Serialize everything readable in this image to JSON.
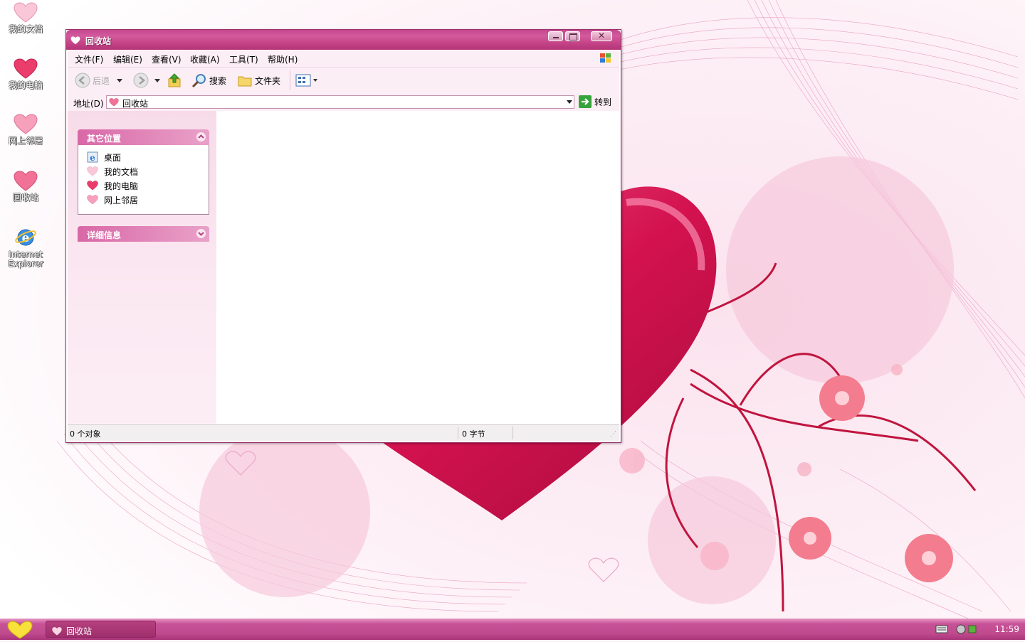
{
  "desktop": {
    "icons": [
      {
        "label": "我的文档"
      },
      {
        "label": "我的电脑"
      },
      {
        "label": "网上邻居"
      },
      {
        "label": "回收站"
      },
      {
        "label": "Internet Explorer"
      }
    ]
  },
  "window": {
    "title": "回收站",
    "menu": [
      "文件(F)",
      "编辑(E)",
      "查看(V)",
      "收藏(A)",
      "工具(T)",
      "帮助(H)"
    ],
    "toolbar": {
      "back": "后退",
      "search": "搜索",
      "folders": "文件夹"
    },
    "address": {
      "label": "地址(D)",
      "value": "回收站",
      "go": "转到"
    },
    "taskpane": {
      "other_places": {
        "title": "其它位置",
        "items": [
          "桌面",
          "我的文档",
          "我的电脑",
          "网上邻居"
        ]
      },
      "details": {
        "title": "详细信息"
      }
    },
    "status": {
      "objects": "0 个对象",
      "size": "0 字节"
    }
  },
  "taskbar": {
    "task_label": "回收站",
    "clock": "11:59"
  },
  "colors": {
    "accent": "#c34285",
    "taskpane_header": "#d868a6",
    "heart": "#d0154e"
  }
}
